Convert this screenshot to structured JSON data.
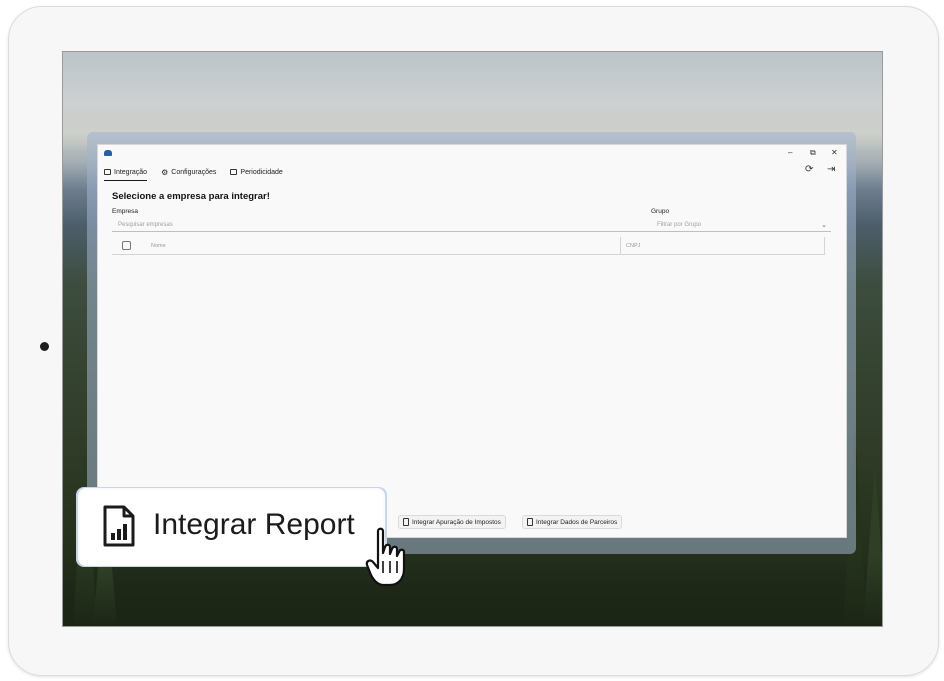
{
  "app": {
    "tabs": [
      {
        "label": "Integração",
        "icon": "monitor-icon",
        "active": true
      },
      {
        "label": "Configurações",
        "icon": "gear-icon",
        "active": false
      },
      {
        "label": "Periodicidade",
        "icon": "calendar-icon",
        "active": false
      }
    ],
    "window_controls": {
      "minimize": "–",
      "restore": "⧉",
      "close": "✕"
    },
    "heading": "Selecione a empresa para integrar!",
    "empresa": {
      "label": "Empresa",
      "placeholder": "Pesquisar empresas"
    },
    "grupo": {
      "label": "Grupo",
      "placeholder": "Filtrar por Grupo"
    },
    "table": {
      "columns": [
        "Nome",
        "CNPJ"
      ]
    },
    "buttons": [
      {
        "label": "Integrar Apuração de Impostos"
      },
      {
        "label": "Integrar Dados de Parceiros"
      }
    ]
  },
  "callout": {
    "label": "Integrar Report",
    "icon": "report-document-icon"
  },
  "colors": {
    "accent": "#2b5da8",
    "glass": "#a0b4cd"
  }
}
